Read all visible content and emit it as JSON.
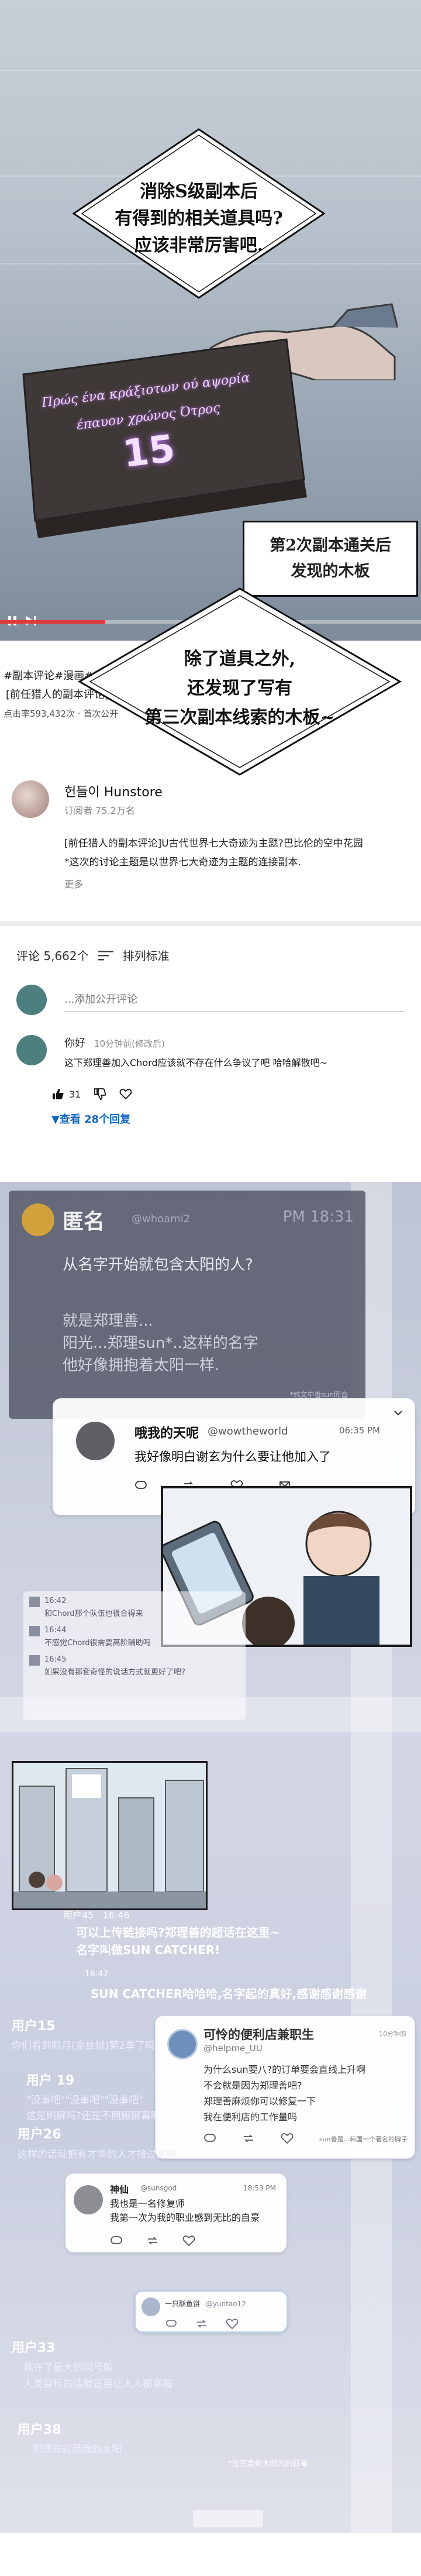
{
  "panel1": {
    "tablet_inscription_line1": "Πρώς ένα κράξιοτων ού αψορία",
    "tablet_inscription_line2": "έπαυον χρώνος Ότρος",
    "tablet_number": "15",
    "bubble_lines": [
      "消除S级副本后",
      "有得到的相关道具吗?",
      "应该非常厉害吧."
    ],
    "caption_lines": [
      "第2次副本通关后",
      "发现的木板"
    ],
    "video_progress": 0.25
  },
  "bubble2": {
    "lines": [
      "除了道具之外,",
      "还发现了写有",
      "第三次副本线索的木板~"
    ]
  },
  "overlay": {
    "tags": "#副本评论#漫画#HN公会#C",
    "title": "[前任猎人的副本评论]U古代",
    "views": "点击率593,432次 · 首次公开"
  },
  "channel": {
    "name": "헌들이 Hunstore",
    "subscribers": "订阅者 75.2万名",
    "description_lines": [
      "[前任猎人的副本评论]U古代世界七大奇迹为主题?巴比伦的空中花园",
      "*这次的讨论主题是以世界七大奇迹为主题的连接副本."
    ],
    "more": "更多"
  },
  "comments": {
    "count_label": "评论 5,662个",
    "sort_label": "排列标准",
    "add_placeholder": "...添加公开评论",
    "first": {
      "user": "你好",
      "time": "10分钟前(修改后)",
      "text": "这下郑理善加入Chord应该就不存在什么争议了吧 哈哈解散吧~",
      "likes": "31",
      "view_replies": "▼查看 28个回复"
    }
  },
  "panel2": {
    "anon": {
      "name": "匿名",
      "handle": "@whoami2",
      "time": "PM 18:31",
      "question": "从名字开始就包含太阳的人?",
      "body_lines": [
        "就是郑理善...",
        "阳光...郑理sun*..这样的名字",
        "他好像拥抱着太阳一样."
      ],
      "side_note": "*韩文中善sun同音"
    },
    "wow": {
      "name": "哦我的天呢",
      "handle": "@wowtheworld",
      "time": "06:35 PM",
      "text": "我好像明白谢玄为什么要让他加入了"
    },
    "mini": {
      "time1": "16:42",
      "line1": "和Chord那个队伍也很合得来",
      "time2": "16:44",
      "line2": "不感觉Chord很需要高阶辅助吗",
      "time3": "16:45",
      "line3": "如果没有那套奇怪的说话方式就更好了吧?"
    },
    "feed": {
      "user": "用户45",
      "time": "16:46",
      "q_lines": [
        "可以上传链接吗?郑理善的超话在这里~",
        "名字叫做SUN CATCHER!"
      ],
      "time2": "16:47",
      "sun_line": "SUN CATCHER哈哈哈,名字起的真好,感谢感谢感谢"
    },
    "biz": {
      "name": "可怜的便利店兼职生",
      "handle": "@helpme_UU",
      "time": "10分钟前",
      "text_lines": [
        "为什么sun要八?的订单要会直线上升啊",
        "不会就是因为郑理善吧?",
        "郑理善麻烦你可以修复一下",
        "我在便利店的工作量吗"
      ],
      "foot": "sun善是...韩国一个著名的牌子"
    },
    "god": {
      "name": "神仙",
      "handle": "@sunsgod",
      "time": "18:53 PM",
      "text_lines": [
        "我也是一名修复师",
        "我第一次为我的职业感到无比的自豪"
      ]
    },
    "fish": {
      "name": "一只酥鱼饼",
      "handle": "@yuntao12"
    },
    "pale": {
      "u15": "用户15",
      "b15": "你们看到斜月(金丝狱)第2季了吗",
      "u19": "用户 19",
      "b19a": "\"没事吧\"\"没事吧\"\"没事吧\"",
      "b19b": "这是刷屏吗?还是不照顾屏幕啊",
      "u26": "用户26",
      "b26": "这样的话就把有才华的人才接过来吧",
      "u33": "用户33",
      "b33a": "我在了最大的问号般,",
      "b33b": "人类目标的话就是要让人人都幸福",
      "u38": "用户38",
      "b38": "郑理善就是我的太阳",
      "caption_end": "*光芒类似太阳光的日晕"
    }
  },
  "colors": {
    "accent_blue": "#1565c0",
    "dark_card": "#50546e",
    "progress_red": "#e03a3a"
  },
  "icons": [
    "thumbs-up-icon",
    "thumbs-down-icon",
    "heart-icon",
    "sort-icon",
    "chevron-down-icon",
    "reply-icon",
    "retweet-icon",
    "share-icon"
  ]
}
